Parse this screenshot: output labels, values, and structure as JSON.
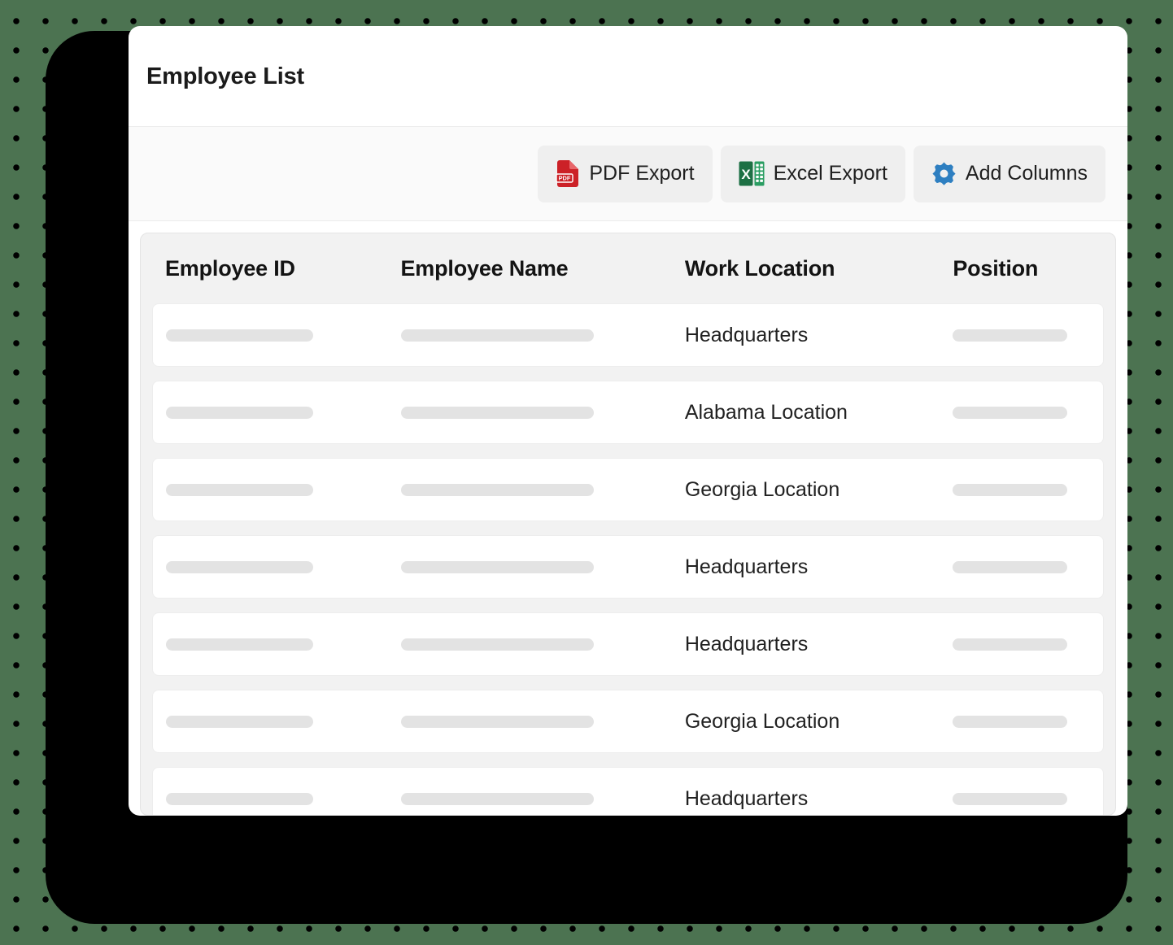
{
  "background": {
    "color": "#4c7351",
    "dot_color": "#000000",
    "shadow_block_color": "#000000"
  },
  "header": {
    "title": "Employee List"
  },
  "toolbar": {
    "buttons": [
      {
        "label": "PDF Export",
        "icon": "pdf-file-icon",
        "accent": "#cc2127"
      },
      {
        "label": "Excel Export",
        "icon": "excel-file-icon",
        "accent": "#1d7044"
      },
      {
        "label": "Add Columns",
        "icon": "gear-icon",
        "accent": "#2e7fc1"
      }
    ]
  },
  "table": {
    "columns": [
      "Employee ID",
      "Employee Name",
      "Work Location",
      "Position"
    ],
    "rows": [
      {
        "employee_id": "",
        "employee_name": "",
        "work_location": "Headquarters",
        "position": ""
      },
      {
        "employee_id": "",
        "employee_name": "",
        "work_location": "Alabama Location",
        "position": ""
      },
      {
        "employee_id": "",
        "employee_name": "",
        "work_location": "Georgia Location",
        "position": ""
      },
      {
        "employee_id": "",
        "employee_name": "",
        "work_location": "Headquarters",
        "position": ""
      },
      {
        "employee_id": "",
        "employee_name": "",
        "work_location": "Headquarters",
        "position": ""
      },
      {
        "employee_id": "",
        "employee_name": "",
        "work_location": "Georgia Location",
        "position": ""
      },
      {
        "employee_id": "",
        "employee_name": "",
        "work_location": "Headquarters",
        "position": ""
      }
    ],
    "placeholder_columns": [
      "Employee ID",
      "Employee Name",
      "Position"
    ]
  }
}
